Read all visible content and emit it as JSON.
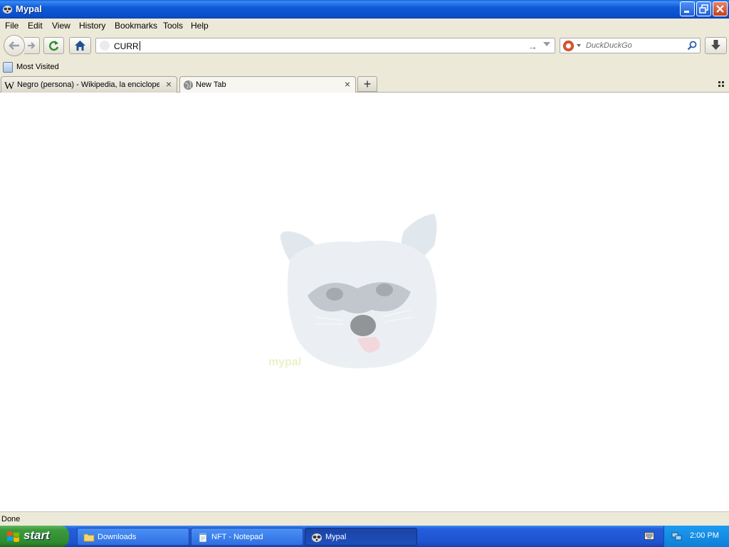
{
  "window": {
    "title": "Mypal"
  },
  "menu": [
    "File",
    "Edit",
    "View",
    "History",
    "Bookmarks",
    "Tools",
    "Help"
  ],
  "navbar": {
    "url_value": "CURR",
    "search_placeholder": "DuckDuckGo"
  },
  "bookmarks": {
    "items": [
      {
        "label": "Most Visited",
        "icon": "bookmarks-folder-icon"
      }
    ]
  },
  "tabs": [
    {
      "label": "Negro (persona) - Wikipedia, la enciclope...",
      "icon": "wikipedia-icon",
      "active": false
    },
    {
      "label": "New Tab",
      "icon": "globe-icon",
      "active": true
    }
  ],
  "content": {
    "logo_caption": "mypal"
  },
  "status": {
    "text": "Done"
  },
  "taskbar": {
    "start_label": "start",
    "tasks": [
      {
        "label": "Downloads",
        "icon": "folder-icon",
        "active": false
      },
      {
        "label": "NFT - Notepad",
        "icon": "notepad-icon",
        "active": false
      },
      {
        "label": "Mypal",
        "icon": "mypal-icon",
        "active": true
      }
    ],
    "clock": "2:00 PM"
  },
  "colors": {
    "titlebar": "#0a4ec9",
    "chrome": "#ece9d8",
    "taskbar": "#245edb",
    "start": "#3c9a3c"
  }
}
